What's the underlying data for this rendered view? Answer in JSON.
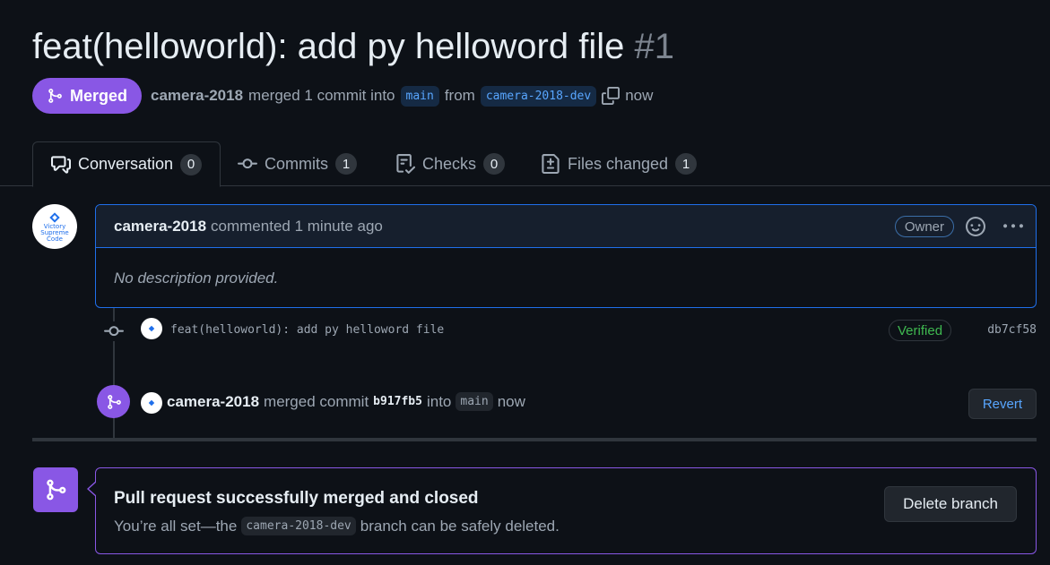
{
  "pr": {
    "title": "feat(helloworld): add py helloword file",
    "number": "#1",
    "state": "Merged",
    "author": "camera-2018",
    "merged_text": "merged 1 commit into",
    "base_branch": "main",
    "from_text": "from",
    "head_branch": "camera-2018-dev",
    "time": "now"
  },
  "tabs": [
    {
      "label": "Conversation",
      "count": "0",
      "icon": "comment-discussion-icon"
    },
    {
      "label": "Commits",
      "count": "1",
      "icon": "git-commit-icon"
    },
    {
      "label": "Checks",
      "count": "0",
      "icon": "checklist-icon"
    },
    {
      "label": "Files changed",
      "count": "1",
      "icon": "file-diff-icon"
    }
  ],
  "avatar": {
    "logo_line1": "Victory",
    "logo_line2": "Supreme",
    "logo_line3": "Code"
  },
  "comment": {
    "author": "camera-2018",
    "action": "commented 1 minute ago",
    "role_badge": "Owner",
    "body": "No description provided."
  },
  "commit": {
    "message": "feat(helloworld): add py helloword file",
    "verified": "Verified",
    "sha": "db7cf58"
  },
  "merge_event": {
    "author": "camera-2018",
    "text": "merged commit",
    "sha": "b917fb5",
    "into_text": "into",
    "branch": "main",
    "time": "now",
    "revert_label": "Revert"
  },
  "merged_box": {
    "title": "Pull request successfully merged and closed",
    "sub_prefix": "You’re all set—the",
    "branch": "camera-2018-dev",
    "sub_suffix": "branch can be safely deleted.",
    "delete_label": "Delete branch"
  },
  "colors": {
    "merged": "#8957e5",
    "accent_blue": "#58a6ff",
    "verified_green": "#3fb950",
    "background": "#0d1117"
  }
}
